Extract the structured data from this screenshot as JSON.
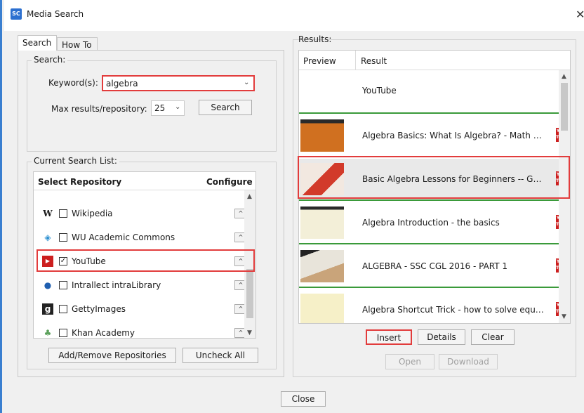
{
  "window": {
    "title": "Media Search",
    "app_icon_text": "SC"
  },
  "tabs": [
    {
      "label": "Search"
    },
    {
      "label": "How To"
    }
  ],
  "search": {
    "group_label": "Search:",
    "keyword_label": "Keyword(s):",
    "keyword_value": "algebra",
    "max_label": "Max results/repository:",
    "max_value": "25",
    "search_button": "Search"
  },
  "repo_list": {
    "group_label": "Current Search List:",
    "header_repository": "Select Repository",
    "header_configure": "Configure",
    "items": [
      {
        "name": "Wikipedia",
        "icon": "wikipedia-icon",
        "glyph": "W",
        "checked": false
      },
      {
        "name": "WU Academic Commons",
        "icon": "wu-commons-icon",
        "glyph": "◈",
        "checked": false
      },
      {
        "name": "YouTube",
        "icon": "youtube-icon",
        "glyph": "▶",
        "checked": true
      },
      {
        "name": "Intrallect intraLibrary",
        "icon": "intralibrary-icon",
        "glyph": "●",
        "checked": false
      },
      {
        "name": "GettyImages",
        "icon": "gettyimages-icon",
        "glyph": "g",
        "checked": false
      },
      {
        "name": "Khan Academy",
        "icon": "khan-academy-icon",
        "glyph": "♣",
        "checked": false
      }
    ],
    "add_remove_button": "Add/Remove Repositories",
    "uncheck_all_button": "Uncheck All"
  },
  "results": {
    "label": "Results:",
    "col_preview": "Preview",
    "col_result": "Result",
    "group_title": "YouTube",
    "badge_text": "You Tube",
    "rows": [
      {
        "title": "Algebra Basics: What Is Algebra? - Math Antics",
        "selected": false
      },
      {
        "title": "Basic Algebra Lessons for Beginners -- Get th...",
        "selected": true
      },
      {
        "title": "Algebra Introduction - the basics",
        "selected": false
      },
      {
        "title": "ALGEBRA - SSC CGL 2016 - PART 1",
        "selected": false
      },
      {
        "title": "Algebra Shortcut Trick  - how to solve equation...",
        "selected": false
      }
    ],
    "insert_button": "Insert",
    "details_button": "Details",
    "clear_button": "Clear",
    "open_button": "Open",
    "download_button": "Download"
  },
  "footer": {
    "close_button": "Close"
  },
  "colors": {
    "highlight": "#e23c3c",
    "accent": "#3a7fd0",
    "row_divider": "#3a9a3a",
    "youtube_red": "#cc1f1f"
  }
}
